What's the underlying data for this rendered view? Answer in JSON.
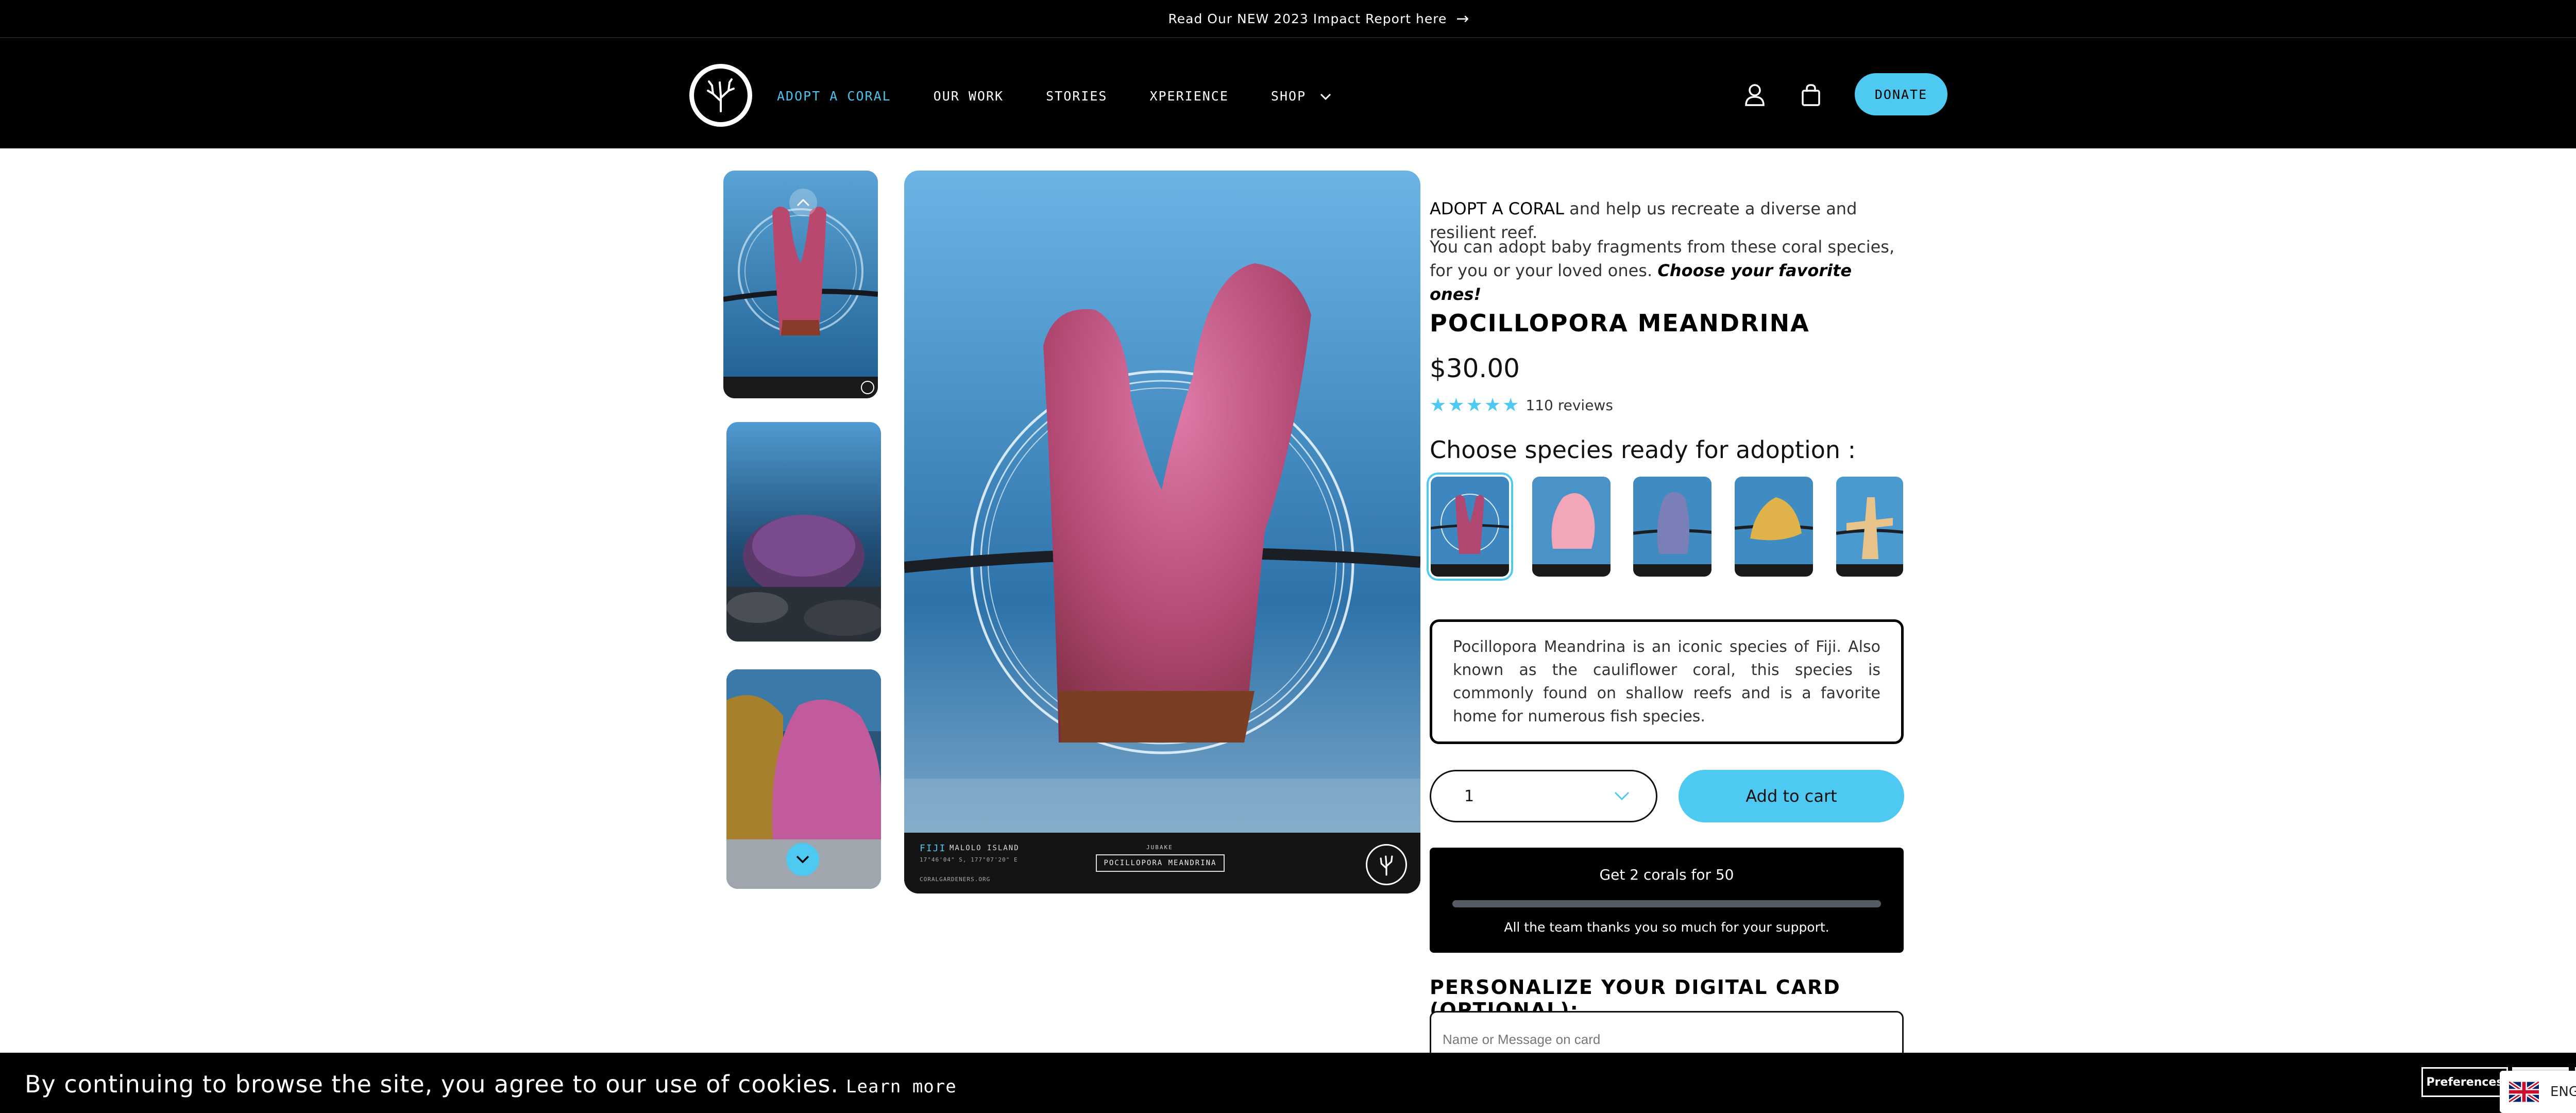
{
  "announcement": {
    "text": "Read Our NEW 2023 Impact Report here",
    "arrow": "→"
  },
  "nav": {
    "items": [
      {
        "label": "ADOPT A CORAL",
        "active": true
      },
      {
        "label": "OUR WORK"
      },
      {
        "label": "STORIES"
      },
      {
        "label": "XPERIENCE"
      },
      {
        "label": "SHOP",
        "dropdown": true
      }
    ],
    "dropdown_chevron": "⌄",
    "icons": [
      "account-icon",
      "cart-icon"
    ],
    "donate_label": "DONATE"
  },
  "gallery": {
    "up_arrow": "⌃",
    "down_arrow": "⌄",
    "main_footer": {
      "region": "FIJI",
      "island": "MALOLO ISLAND",
      "coords": "17°46'04\" S, 177°07'20\" E",
      "site": "CORALGARDENERS.ORG",
      "label": "JUBAKE",
      "species": "POCILLOPORA MEANDRINA"
    }
  },
  "product": {
    "intro_bold": "ADOPT A CORAL",
    "intro_rest": " and help us recreate a diverse and resilient reef.",
    "desc_plain": "You can adopt baby fragments from these coral species, for you or your loved ones. ",
    "desc_em": "Choose your favorite ones!",
    "title": "POCILLOPORA MEANDRINA",
    "price": "$30.00",
    "stars": "★★★★★",
    "rating": 5,
    "reviews": "110 reviews",
    "choose_label": "Choose species ready for adoption :",
    "species_description": "Pocillopora Meandrina is an iconic species of Fiji. Also known as the cauliflower coral, this species is commonly found on shallow reefs and is a favorite home for numerous fish species.",
    "quantity": "1",
    "quantity_chevron": "⌄",
    "add_to_cart": "Add to cart",
    "promo_title": "Get 2 corals for 50",
    "promo_progress": 0,
    "promo_thanks": "All the team thanks you so much for your support.",
    "personalize_label": "PERSONALIZE YOUR DIGITAL CARD (OPTIONAL):",
    "card_placeholder": "Name or Message on card"
  },
  "cookie": {
    "text": "By continuing to browse the site, you agree to our use of cookies.",
    "learn_more": "Learn more",
    "preferences": "Preferences"
  },
  "language": {
    "code": "ENG",
    "chevron": "›"
  },
  "colors": {
    "accent": "#4ec9f2",
    "dark": "#000000"
  }
}
